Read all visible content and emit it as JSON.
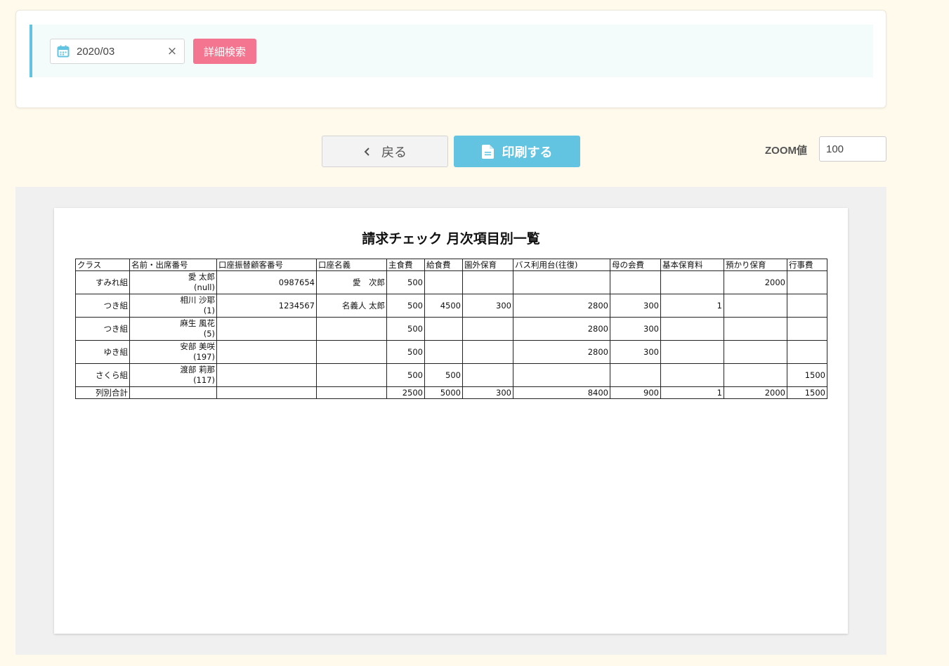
{
  "search": {
    "date_value": "2020/03",
    "clear_symbol": "×",
    "detail_button": "詳細検索"
  },
  "actions": {
    "back_label": "戻る",
    "print_label": "印刷する",
    "zoom_label": "ZOOM値",
    "zoom_value": "100"
  },
  "report": {
    "title": "請求チェック 月次項目別一覧",
    "columns": [
      "クラス",
      "名前・出席番号",
      "口座振替顧客番号",
      "口座名義",
      "主食費",
      "給食費",
      "園外保育",
      "バス利用台(往復)",
      "母の会費",
      "基本保育料",
      "預かり保育",
      "行事費"
    ],
    "rows": [
      {
        "class": "すみれ組",
        "name": "愛 太郎",
        "number": "(null)",
        "account_no": "0987654",
        "account_name": "愛　次郎",
        "v": [
          "500",
          "",
          "",
          "",
          "",
          "",
          "2000",
          ""
        ]
      },
      {
        "class": "つき組",
        "name": "相川 沙耶",
        "number": "(1)",
        "account_no": "1234567",
        "account_name": "名義人 太郎",
        "v": [
          "500",
          "4500",
          "300",
          "2800",
          "300",
          "1",
          "",
          ""
        ]
      },
      {
        "class": "つき組",
        "name": "麻生 風花",
        "number": "(5)",
        "account_no": "",
        "account_name": "",
        "v": [
          "500",
          "",
          "",
          "2800",
          "300",
          "",
          "",
          ""
        ]
      },
      {
        "class": "ゆき組",
        "name": "安部 美咲",
        "number": "(197)",
        "account_no": "",
        "account_name": "",
        "v": [
          "500",
          "",
          "",
          "2800",
          "300",
          "",
          "",
          ""
        ]
      },
      {
        "class": "さくら組",
        "name": "渡部 莉那",
        "number": "(117)",
        "account_no": "",
        "account_name": "",
        "v": [
          "500",
          "500",
          "",
          "",
          "",
          "",
          "",
          "1500"
        ]
      }
    ],
    "total": {
      "label": "列別合計",
      "v": [
        "2500",
        "5000",
        "300",
        "8400",
        "900",
        "1",
        "2000",
        "1500"
      ]
    }
  },
  "colors": {
    "page_bg": "#fffaec",
    "accent_blue": "#63c4e1",
    "accent_pink": "#f47590"
  }
}
